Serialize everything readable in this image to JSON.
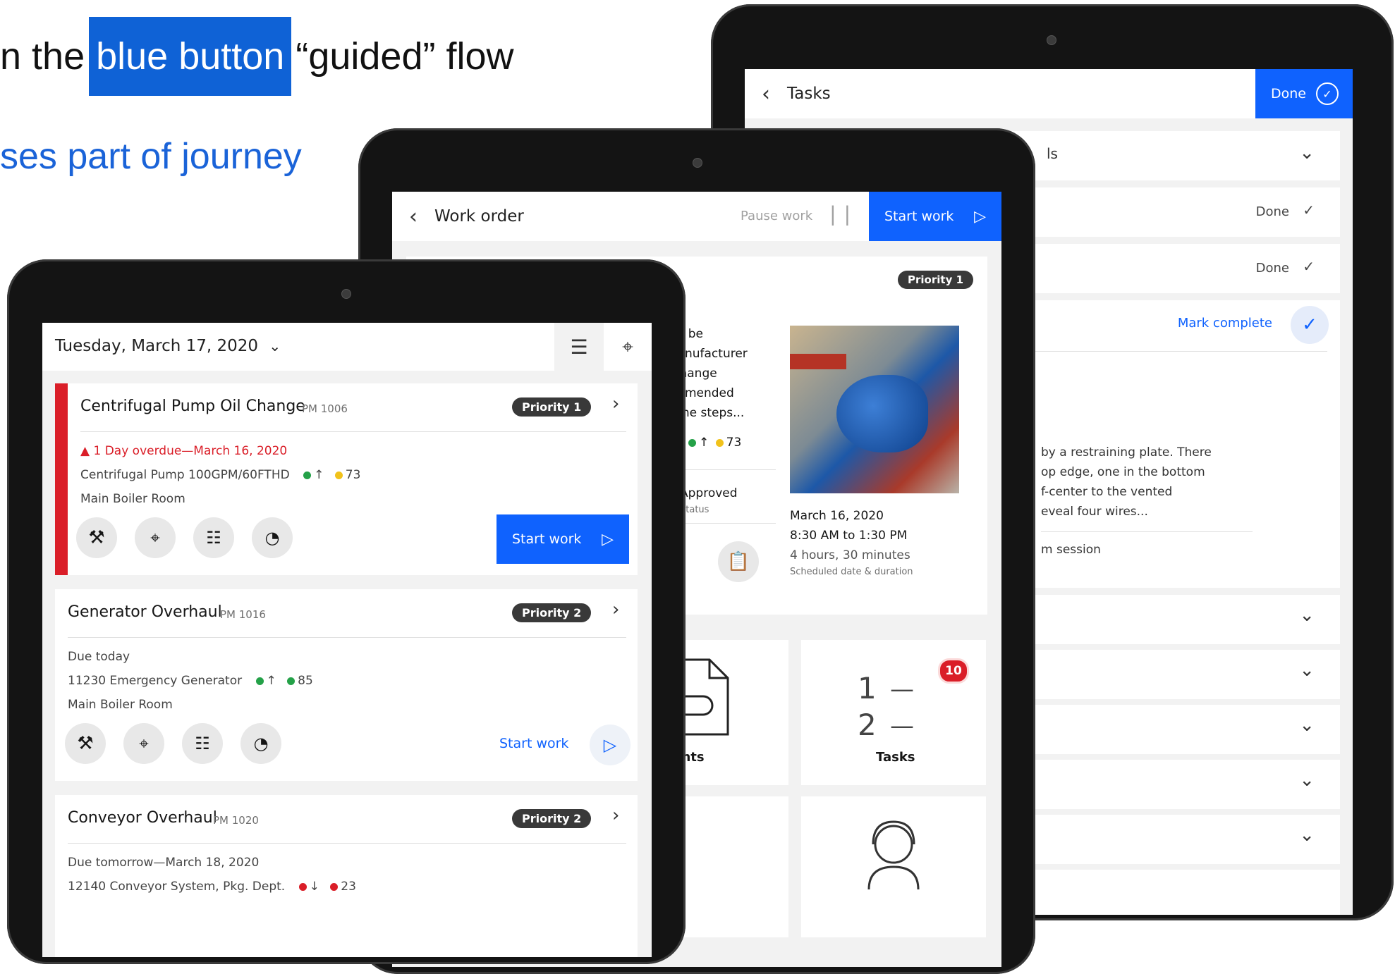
{
  "captions": {
    "line1_pre": "n the",
    "line1_highlight": "blue button",
    "line1_post": "“guided” flow",
    "line2": "ses part of journey"
  },
  "colors": {
    "primary": "#0f62fe",
    "overdue": "#da1e28",
    "green": "#24a148",
    "yellow": "#f1c21b"
  },
  "back_tablet": {
    "header_title": "Tasks",
    "done_label": "Done",
    "rows": [
      {
        "text": "ls",
        "kind": "chevron"
      },
      {
        "text": "Done",
        "kind": "done"
      },
      {
        "text": "Done",
        "kind": "done"
      },
      {
        "text": "Mark complete",
        "kind": "mark"
      }
    ],
    "desc_lines": [
      "by a restraining plate. There",
      "op edge, one in the bottom",
      "f-center to the vented",
      "eveal four wires..."
    ],
    "session_text": "m session"
  },
  "mid_tablet": {
    "header_title": "Work order",
    "pause_label": "Pause work",
    "start_label": "Start work",
    "priority": "Priority 1",
    "desc_lines": [
      "ust be",
      "manufacturer",
      "l change",
      "ommended",
      "n the steps..."
    ],
    "meter_value": "73",
    "status_value": "Approved",
    "status_label": "Status",
    "sched_date": "March 16, 2020",
    "sched_time": "8:30 AM to 1:30 PM",
    "sched_duration": "4 hours, 30 minutes",
    "sched_label": "Scheduled date & duration",
    "attachments_label": "chments",
    "tasks_label": "Tasks",
    "tasks_badge": "10",
    "tasks_num1": "1",
    "tasks_num2": "2"
  },
  "front_tablet": {
    "date": "Tuesday, March 17, 2020",
    "orders": [
      {
        "title": "Centrifugal Pump Oil Change",
        "code": "PM 1006",
        "priority": "Priority 1",
        "due": "1 Day overdue—March 16, 2020",
        "asset": "Centrifugal Pump 100GPM/60FTHD",
        "meter": "73",
        "location": "Main Boiler Room",
        "action": "Start work"
      },
      {
        "title": "Generator Overhaul",
        "code": "PM 1016",
        "priority": "Priority 2",
        "due": "Due today",
        "asset": "11230 Emergency Generator",
        "meter": "85",
        "location": "Main Boiler Room",
        "action": "Start work"
      },
      {
        "title": "Conveyor Overhaul",
        "code": "PM 1020",
        "priority": "Priority 2",
        "due": "Due tomorrow—March 18, 2020",
        "asset": "12140 Conveyor System, Pkg. Dept.",
        "meter": "23"
      }
    ]
  }
}
